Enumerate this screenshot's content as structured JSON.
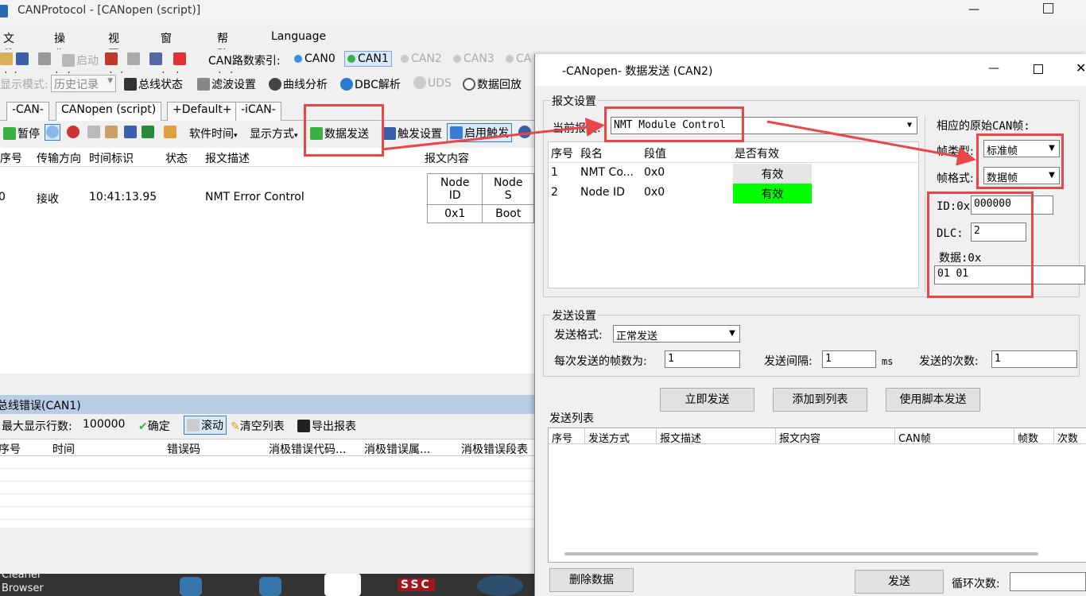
{
  "app": {
    "title": "CANProtocol - [CANopen (script)]",
    "menu": [
      "文件(F)",
      "操作(O)",
      "视图(V)",
      "窗口(W)",
      "帮助(H)",
      "Language"
    ]
  },
  "toolbar1": {
    "start_label": "启动",
    "can_index_label": "CAN路数索引:",
    "channels": [
      "CAN0",
      "CAN1",
      "CAN2",
      "CAN3",
      "CA"
    ]
  },
  "toolbar2": {
    "display_mode_label": "显示模式:",
    "display_mode_value": "历史记录",
    "items": [
      "总线状态",
      "滤波设置",
      "曲线分析",
      "DBC解析",
      "UDS",
      "数据回放"
    ]
  },
  "tabs": [
    "-CAN-",
    "CANopen (script)",
    "+Default+",
    "-iCAN-"
  ],
  "toolbar3": {
    "pause": "暂停",
    "software_time": "软件时间",
    "display_format": "显示方式",
    "data_send": "数据发送",
    "trigger_settings": "触发设置",
    "enable_trigger": "启用触发"
  },
  "main_grid": {
    "columns": [
      "序号",
      "传输方向",
      "时间标识",
      "状态",
      "报文描述",
      "报文内容"
    ],
    "rows": [
      {
        "index": "0",
        "direction": "接收",
        "time": "10:41:13.95",
        "status": "",
        "description": "NMT Error Control",
        "content_headers": [
          "Node ID",
          "Node S"
        ],
        "content_values": [
          "0x1",
          "Boot"
        ]
      }
    ]
  },
  "bus_error": {
    "title": "总线错误(CAN1)",
    "max_rows_label": "最大显示行数:",
    "max_rows_value": "100000",
    "confirm": "确定",
    "scroll": "滚动",
    "clear": "清空列表",
    "export": "导出报表",
    "columns": [
      "序号",
      "时间",
      "错误码",
      "消极错误代码...",
      "消极错误属...",
      "消极错误段表"
    ]
  },
  "taskbar": {
    "items": [
      "Cleaner",
      "Browser",
      "SSC"
    ]
  },
  "dialog": {
    "title": "-CANopen- 数据发送 (CAN2)",
    "message_settings": "报文设置",
    "message_label": "文:",
    "message_value": "NMT Module Control",
    "segment_columns": [
      "序号",
      "段名",
      "段值",
      "是否有效"
    ],
    "segments": [
      {
        "index": "1",
        "name": "NMT Co...",
        "value": "0x0",
        "valid": "有效",
        "highlight": false
      },
      {
        "index": "2",
        "name": "Node ID",
        "value": "0x0",
        "valid": "有效",
        "highlight": true
      }
    ],
    "raw_frame_label": "相应的原始CAN帧:",
    "frame_type_label": "帧类型:",
    "frame_type_value": "标准帧",
    "frame_format_label": "帧格式:",
    "frame_format_value": "数据帧",
    "id_label": "ID:0x",
    "id_value": "000000",
    "dlc_label": "DLC:",
    "dlc_value": "2",
    "data_label": "数据:0x",
    "data_value": "01 01",
    "send_settings": "发送设置",
    "send_format_label": "发送格式:",
    "send_format_value": "正常发送",
    "frames_per_send_label": "每次发送的帧数为:",
    "frames_per_send_value": "1",
    "interval_label": "发送间隔:",
    "interval_value": "1",
    "interval_unit": "ms",
    "send_count_label": "发送的次数:",
    "send_count_value": "1",
    "send_now": "立即发送",
    "add_to_list": "添加到列表",
    "script_send": "使用脚本发送",
    "send_list_label": "发送列表",
    "send_list_columns": [
      "序号",
      "发送方式",
      "报文描述",
      "报文内容",
      "CAN帧",
      "帧数",
      "次数"
    ],
    "delete_data": "删除数据",
    "send": "发送",
    "loop_count_label": "循环次数:",
    "loop_count_value": ""
  },
  "colors": {
    "annotation": "#e8474a",
    "valid_highlight": "#00ff00",
    "bus_error_title_bg": "#b8cde3"
  }
}
